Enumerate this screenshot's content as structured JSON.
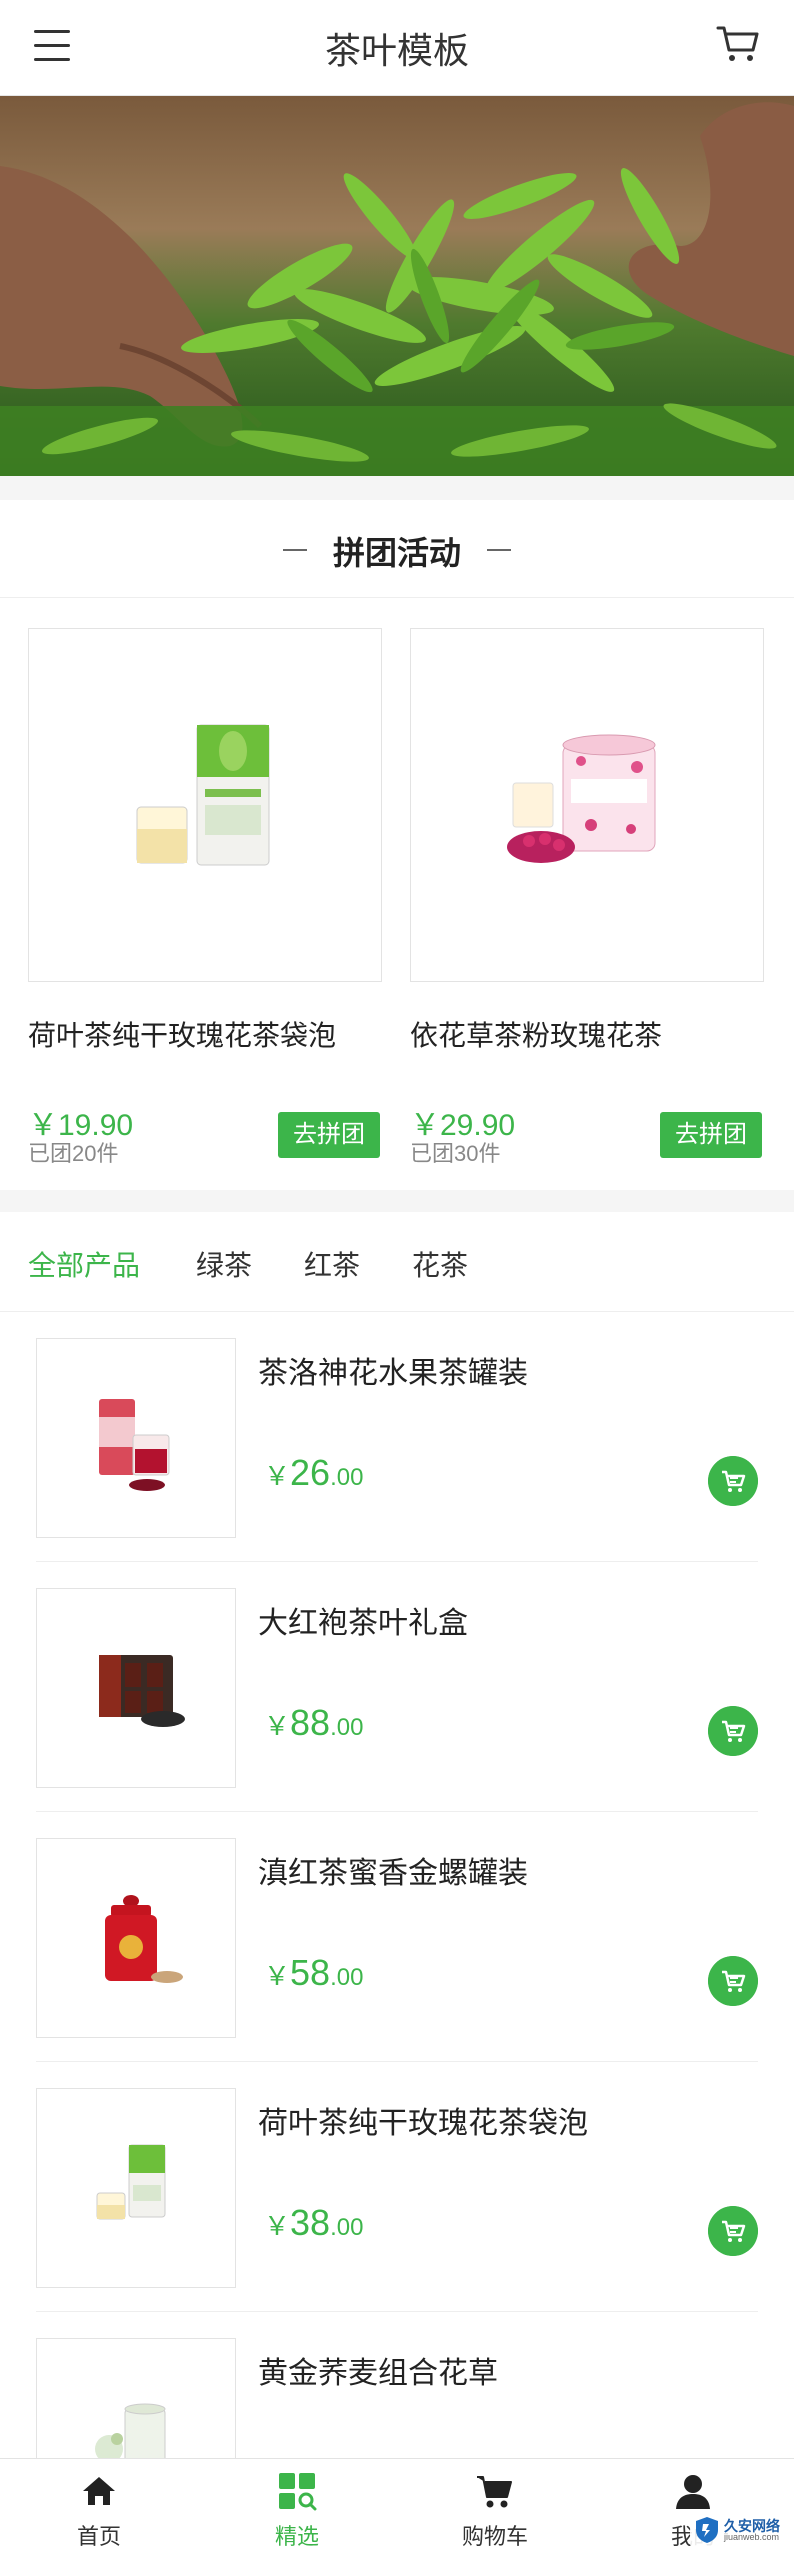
{
  "header": {
    "title": "茶叶模板",
    "menu_icon": "menu-icon",
    "cart_icon": "cart-icon"
  },
  "banner": {
    "image": "hands-holding-green-tea-leaves"
  },
  "group_buy": {
    "title": "拼团活动",
    "items": [
      {
        "name": "荷叶茶纯干玫瑰花茶袋泡",
        "price": "￥19.90",
        "sold": "已团20件",
        "button": "去拼团"
      },
      {
        "name": "依花草茶粉玫瑰花茶",
        "price": "￥29.90",
        "sold": "已团30件",
        "button": "去拼团"
      }
    ]
  },
  "tabs": [
    {
      "label": "全部产品",
      "active": true
    },
    {
      "label": "绿茶",
      "active": false
    },
    {
      "label": "红茶",
      "active": false
    },
    {
      "label": "花茶",
      "active": false
    }
  ],
  "products": [
    {
      "name": "茶洛神花水果茶罐装",
      "yen": "￥",
      "price_int": "26",
      "price_dec": ".00"
    },
    {
      "name": "大红袍茶叶礼盒",
      "yen": "￥",
      "price_int": "88",
      "price_dec": ".00"
    },
    {
      "name": "滇红茶蜜香金螺罐装",
      "yen": "￥",
      "price_int": "58",
      "price_dec": ".00"
    },
    {
      "name": "荷叶茶纯干玫瑰花茶袋泡",
      "yen": "￥",
      "price_int": "38",
      "price_dec": ".00"
    },
    {
      "name": "黄金荞麦组合花草",
      "yen": "",
      "price_int": "",
      "price_dec": ""
    }
  ],
  "bottom_nav": [
    {
      "label": "首页",
      "icon": "home-icon",
      "active": false
    },
    {
      "label": "精选",
      "icon": "grid-search-icon",
      "active": true
    },
    {
      "label": "购物车",
      "icon": "cart-icon",
      "active": false
    },
    {
      "label": "我的",
      "icon": "user-icon",
      "active": false
    }
  ],
  "watermark": {
    "text": "久安网络",
    "sub": "jiuanweb.com"
  },
  "colors": {
    "accent": "#3cb54a",
    "text": "#222222",
    "muted": "#888888"
  }
}
